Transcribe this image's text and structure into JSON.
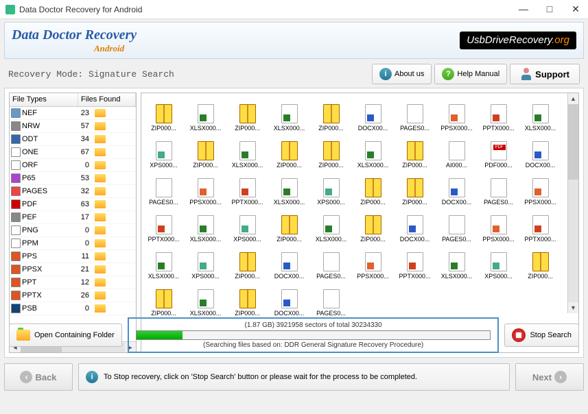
{
  "title": "Data Doctor Recovery for Android",
  "brand": "Data Doctor Recovery",
  "brand_sub": "Android",
  "badge_main": "UsbDriveRecovery",
  "badge_ext": ".org",
  "mode": "Recovery Mode: Signature Search",
  "btn_about": "About us",
  "btn_help": "Help Manual",
  "btn_support": "Support",
  "col_types": "File Types",
  "col_found": "Files Found",
  "file_types": [
    {
      "name": "NEF",
      "count": 23,
      "ic": "#69c"
    },
    {
      "name": "NRW",
      "count": 57,
      "ic": "#888"
    },
    {
      "name": "ODT",
      "count": 34,
      "ic": "#36a"
    },
    {
      "name": "ONE",
      "count": 67,
      "ic": "#fff"
    },
    {
      "name": "ORF",
      "count": 0,
      "ic": "#fff"
    },
    {
      "name": "P65",
      "count": 53,
      "ic": "#a4c"
    },
    {
      "name": "PAGES",
      "count": 32,
      "ic": "#e44"
    },
    {
      "name": "PDF",
      "count": 63,
      "ic": "#c00"
    },
    {
      "name": "PEF",
      "count": 17,
      "ic": "#888"
    },
    {
      "name": "PNG",
      "count": 0,
      "ic": "#fff"
    },
    {
      "name": "PPM",
      "count": 0,
      "ic": "#fff"
    },
    {
      "name": "PPS",
      "count": 11,
      "ic": "#d52"
    },
    {
      "name": "PPSX",
      "count": 21,
      "ic": "#d52"
    },
    {
      "name": "PPT",
      "count": 12,
      "ic": "#d52"
    },
    {
      "name": "PPTX",
      "count": 26,
      "ic": "#d52"
    },
    {
      "name": "PSB",
      "count": 0,
      "ic": "#147"
    }
  ],
  "grid_items": [
    {
      "t": "zip",
      "l": "ZIP000..."
    },
    {
      "t": "xlsx",
      "l": "XLSX000..."
    },
    {
      "t": "zip",
      "l": "ZIP000..."
    },
    {
      "t": "xlsx",
      "l": "XLSX000..."
    },
    {
      "t": "zip",
      "l": "ZIP000..."
    },
    {
      "t": "docx",
      "l": "DOCX00..."
    },
    {
      "t": "pages",
      "l": "PAGES0..."
    },
    {
      "t": "ppsx",
      "l": "PPSX000..."
    },
    {
      "t": "pptx",
      "l": "PPTX000..."
    },
    {
      "t": "xlsx",
      "l": "XLSX000..."
    },
    {
      "t": "xps",
      "l": "XPS000..."
    },
    {
      "t": "zip",
      "l": "ZIP000..."
    },
    {
      "t": "xlsx",
      "l": "XLSX000..."
    },
    {
      "t": "zip",
      "l": "ZIP000..."
    },
    {
      "t": "zip",
      "l": "ZIP000..."
    },
    {
      "t": "xlsx",
      "l": "XLSX000..."
    },
    {
      "t": "zip",
      "l": "ZIP000..."
    },
    {
      "t": "ai",
      "l": "AI000..."
    },
    {
      "t": "pdf",
      "l": "PDF000..."
    },
    {
      "t": "docx",
      "l": "DOCX00..."
    },
    {
      "t": "pages",
      "l": "PAGES0..."
    },
    {
      "t": "ppsx",
      "l": "PPSX000..."
    },
    {
      "t": "pptx",
      "l": "PPTX000..."
    },
    {
      "t": "xlsx",
      "l": "XLSX000..."
    },
    {
      "t": "xps",
      "l": "XPS000..."
    },
    {
      "t": "zip",
      "l": "ZIP000..."
    },
    {
      "t": "zip",
      "l": "ZIP000..."
    },
    {
      "t": "docx",
      "l": "DOCX00..."
    },
    {
      "t": "pages",
      "l": "PAGES0..."
    },
    {
      "t": "ppsx",
      "l": "PPSX000..."
    },
    {
      "t": "pptx",
      "l": "PPTX000..."
    },
    {
      "t": "xlsx",
      "l": "XLSX000..."
    },
    {
      "t": "xps",
      "l": "XPS000..."
    },
    {
      "t": "zip",
      "l": "ZIP000..."
    },
    {
      "t": "xlsx",
      "l": "XLSX000..."
    },
    {
      "t": "zip",
      "l": "ZIP000..."
    },
    {
      "t": "docx",
      "l": "DOCX00..."
    },
    {
      "t": "pages",
      "l": "PAGES0..."
    },
    {
      "t": "ppsx",
      "l": "PPSX000..."
    },
    {
      "t": "pptx",
      "l": "PPTX000..."
    },
    {
      "t": "xlsx",
      "l": "XLSX000..."
    },
    {
      "t": "xps",
      "l": "XPS000..."
    },
    {
      "t": "zip",
      "l": "ZIP000..."
    },
    {
      "t": "docx",
      "l": "DOCX00..."
    },
    {
      "t": "pages",
      "l": "PAGES0..."
    },
    {
      "t": "ppsx",
      "l": "PPSX000..."
    },
    {
      "t": "pptx",
      "l": "PPTX000..."
    },
    {
      "t": "xlsx",
      "l": "XLSX000..."
    },
    {
      "t": "xps",
      "l": "XPS000..."
    },
    {
      "t": "zip",
      "l": "ZIP000..."
    },
    {
      "t": "zip",
      "l": "ZIP000..."
    },
    {
      "t": "xlsx",
      "l": "XLSX000..."
    },
    {
      "t": "zip",
      "l": "ZIP000..."
    },
    {
      "t": "docx",
      "l": "DOCX00..."
    },
    {
      "t": "pages",
      "l": "PAGES0..."
    }
  ],
  "btn_open": "Open Containing Folder",
  "progress_info": "(1.87 GB) 3921958  sectors  of  total 30234330",
  "progress_status": "(Searching files based on:  DDR General Signature Recovery Procedure)",
  "btn_stop": "Stop Search",
  "btn_back": "Back",
  "btn_next": "Next",
  "hint": "To Stop recovery, click on 'Stop Search' button or please wait for the process to be completed."
}
